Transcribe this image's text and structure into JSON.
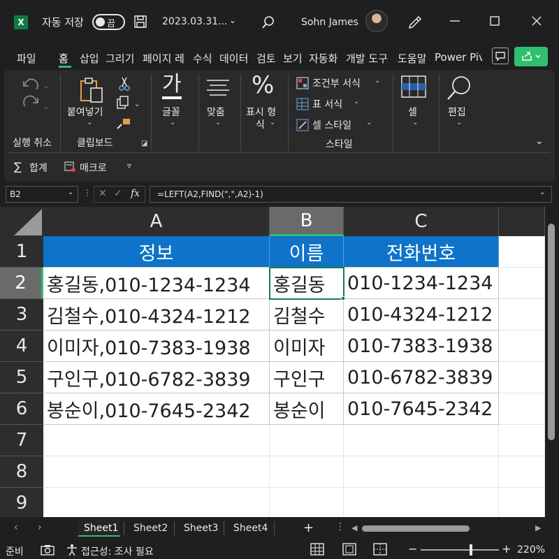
{
  "titlebar": {
    "app_logo": "X",
    "autosave_label": "자동 저장",
    "autosave_state": "끔",
    "filename": "2023.03.31...",
    "username": "Sohn James"
  },
  "tabs": [
    "파일",
    "홈",
    "삽입",
    "그리기",
    "페이지 레",
    "수식",
    "데이터",
    "검토",
    "보기",
    "자동화",
    "개발 도구",
    "도움말",
    "Power Piv"
  ],
  "active_tab": "홈",
  "ribbon": {
    "undo_label": "실행 취소",
    "clipboard_label": "클립보드",
    "paste_label": "붙여넣기",
    "font_glyph": "가",
    "font_label": "글꼴",
    "align_label": "맞춤",
    "number_label_1": "표시 형",
    "number_label_2": "식",
    "percent_glyph": "%",
    "conditional_format": "조건부 서식",
    "table_format": "표 서식",
    "cell_style": "셀 스타일",
    "styles_label": "스타일",
    "cells_label": "셀",
    "edit_label": "편집",
    "sum_label": "합계",
    "macro_label": "매크로"
  },
  "formula_bar": {
    "name_box": "B2",
    "fx": "fx",
    "formula": "=LEFT(A2,FIND(\",\",A2)-1)"
  },
  "columns": [
    "A",
    "B",
    "C"
  ],
  "selected_column": "B",
  "rows": [
    "1",
    "2",
    "3",
    "4",
    "5",
    "6",
    "7",
    "8",
    "9"
  ],
  "selected_row": "2",
  "table": {
    "headers": [
      "정보",
      "이름",
      "전화번호"
    ],
    "rows": [
      [
        "홍길동,010-1234-1234",
        "홍길동",
        "010-1234-1234"
      ],
      [
        "김철수,010-4324-1212",
        "김철수",
        "010-4324-1212"
      ],
      [
        "이미자,010-7383-1938",
        "이미자",
        "010-7383-1938"
      ],
      [
        "구인구,010-6782-3839",
        "구인구",
        "010-6782-3839"
      ],
      [
        "봉순이,010-7645-2342",
        "봉순이",
        "010-7645-2342"
      ]
    ]
  },
  "sheets": [
    "Sheet1",
    "Sheet2",
    "Sheet3",
    "Sheet4"
  ],
  "active_sheet": "Sheet1",
  "status": {
    "ready": "준비",
    "accessibility": "접근성: 조사 필요",
    "zoom": "220%"
  },
  "colors": {
    "header_fill": "#0e73c9",
    "accent": "#2fbf71",
    "selection": "#1d7a45"
  }
}
